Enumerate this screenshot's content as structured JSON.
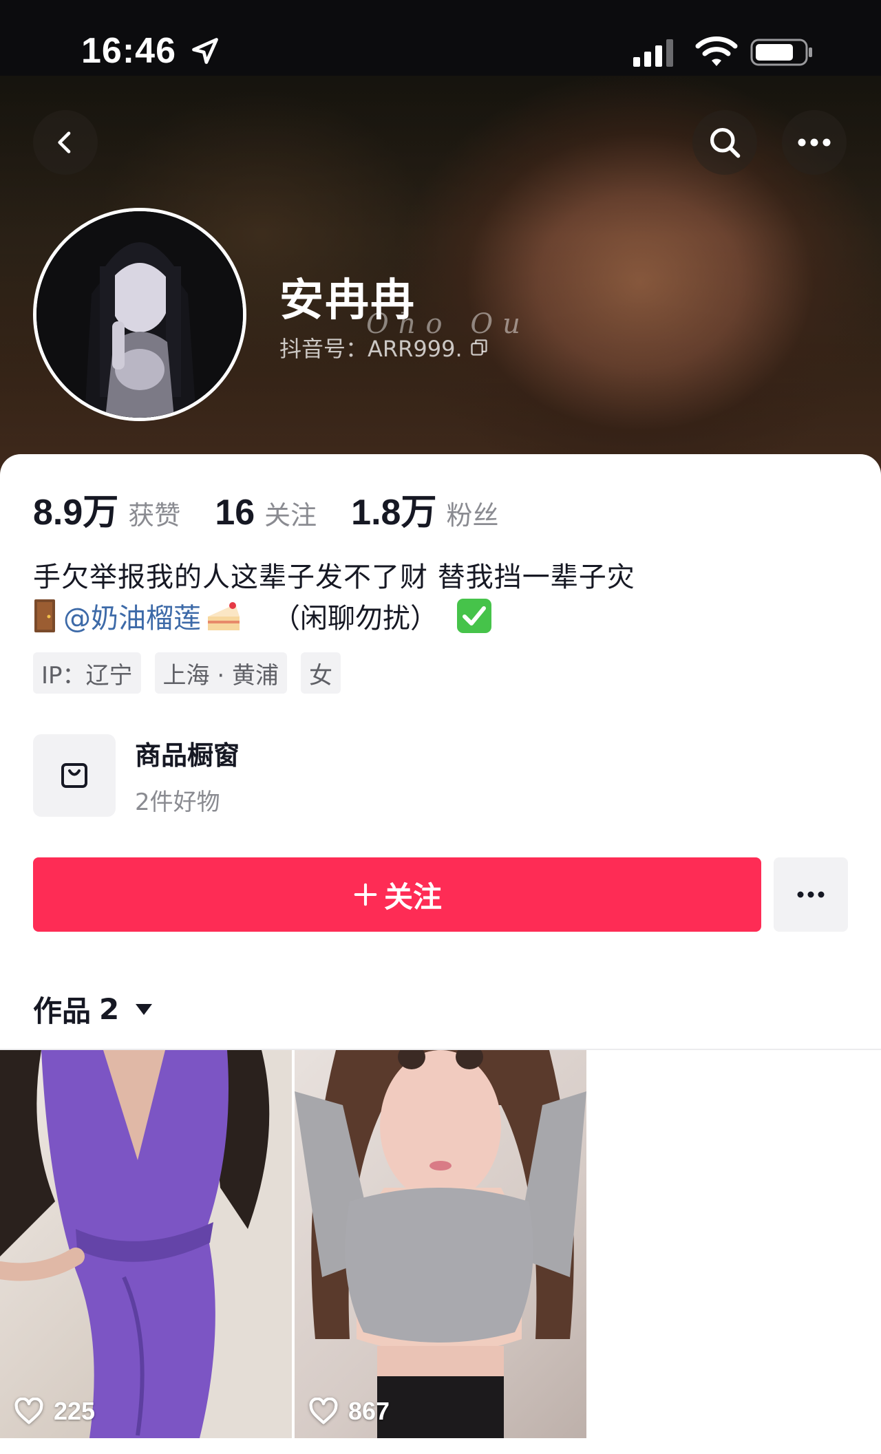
{
  "status_bar": {
    "time": "16:46",
    "icons": [
      "location-arrow-icon",
      "cellular-signal-icon",
      "wifi-icon",
      "battery-icon"
    ]
  },
  "header": {
    "back_icon": "chevron-left-icon",
    "search_icon": "search-icon",
    "more_icon": "more-dots-icon"
  },
  "profile": {
    "nickname": "安冉冉",
    "douyin_id": "抖音号：ARR999.",
    "copy_icon": "copy-icon",
    "watermark": "Oho Ou"
  },
  "stats": [
    {
      "value": "8.9万",
      "label": "获赞"
    },
    {
      "value": "16",
      "label": "关注"
    },
    {
      "value": "1.8万",
      "label": "粉丝"
    }
  ],
  "bio": {
    "line1": "手欠举报我的人这辈子发不了财 替我挡一辈子灾",
    "mention": "@奶油榴莲",
    "note": "（闲聊勿扰）",
    "emoji_icons": [
      "door-icon",
      "cake-icon",
      "check-mark-icon"
    ]
  },
  "tags": [
    "IP：辽宁",
    "上海 · 黄浦",
    "女"
  ],
  "shop": {
    "title": "商品橱窗",
    "subtitle": "2件好物",
    "icon": "shopping-bag-icon"
  },
  "actions": {
    "follow_label": "关注",
    "follow_icon": "plus-icon",
    "more_icon": "more-dots-icon"
  },
  "works": {
    "label": "作品",
    "count": "2",
    "dropdown_icon": "caret-down-icon"
  },
  "videos": [
    {
      "likes": "225",
      "icon": "heart-icon"
    },
    {
      "likes": "867",
      "icon": "heart-icon"
    }
  ],
  "colors": {
    "accent": "#fe2c55",
    "mention": "#3d6aa8",
    "text_primary": "#161823",
    "text_secondary": "#8a8b91",
    "tag_bg": "#f2f2f4"
  }
}
